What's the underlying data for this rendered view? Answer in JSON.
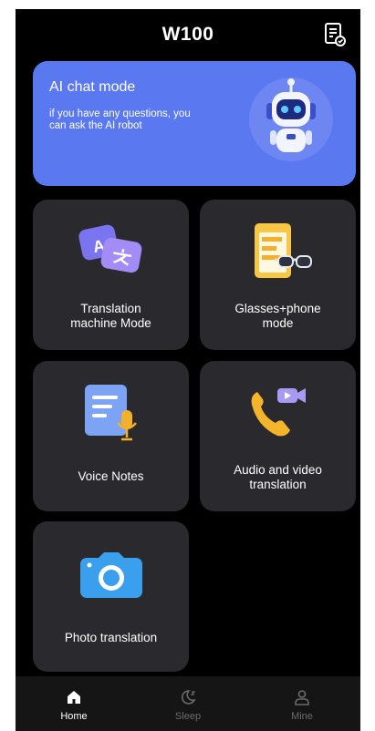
{
  "header": {
    "title": "W100",
    "icon": "document-icon"
  },
  "ai_card": {
    "title": "AI chat mode",
    "subtitle": "if you have any questions, you can ask the AI robot",
    "color": "#5a78f0"
  },
  "tiles": [
    {
      "label": "Translation machine Mode",
      "icon": "translate-icon"
    },
    {
      "label": "Glasses+phone mode",
      "icon": "glasses-phone-icon"
    },
    {
      "label": "Voice Notes",
      "icon": "voice-notes-icon"
    },
    {
      "label": "Audio and video translation",
      "icon": "phone-video-icon"
    },
    {
      "label": "Photo translation",
      "icon": "camera-icon"
    }
  ],
  "nav": [
    {
      "label": "Home",
      "active": true,
      "icon": "home-icon"
    },
    {
      "label": "Sleep",
      "active": false,
      "icon": "moon-icon"
    },
    {
      "label": "Mine",
      "active": false,
      "icon": "user-icon"
    }
  ],
  "colors": {
    "background": "#000000",
    "tile": "#2a2a2e",
    "active_nav": "#ffffff",
    "inactive_nav": "#6b6b6b"
  }
}
